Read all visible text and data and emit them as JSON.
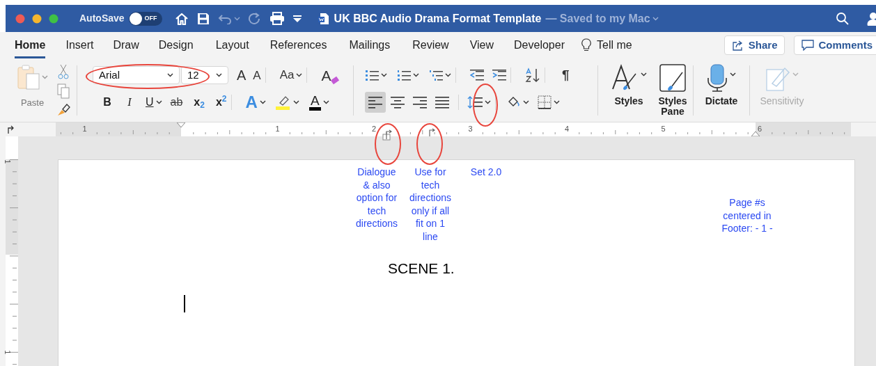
{
  "window": {
    "autosave_label": "AutoSave",
    "autosave": {
      "on": false,
      "label": "OFF"
    },
    "title": "UK BBC Audio Drama Format Template",
    "save_status": "— Saved to my Mac"
  },
  "tabs": [
    {
      "label": "Home",
      "selected": true
    },
    {
      "label": "Insert",
      "selected": false
    },
    {
      "label": "Draw",
      "selected": false
    },
    {
      "label": "Design",
      "selected": false
    },
    {
      "label": "Layout",
      "selected": false
    },
    {
      "label": "References",
      "selected": false
    },
    {
      "label": "Mailings",
      "selected": false
    },
    {
      "label": "Review",
      "selected": false
    },
    {
      "label": "View",
      "selected": false
    },
    {
      "label": "Developer",
      "selected": false
    }
  ],
  "tell_me": "Tell me",
  "header_buttons": [
    {
      "kind": "share",
      "label": "Share"
    },
    {
      "kind": "comments",
      "label": "Comments"
    }
  ],
  "ribbon": {
    "paste_label": "Paste",
    "font_name": "Arial",
    "font_size": "12",
    "font_row1": [
      {
        "kind": "grow",
        "text": "A"
      },
      {
        "kind": "shrink",
        "text": "A"
      },
      {
        "kind": "case",
        "text": "Aa"
      },
      {
        "kind": "clear",
        "text": "A"
      }
    ],
    "font_row2": [
      {
        "kind": "bold",
        "text": "B"
      },
      {
        "kind": "italic",
        "text": "I"
      },
      {
        "kind": "underline",
        "text": "U"
      },
      {
        "kind": "strike",
        "text": "ab"
      },
      {
        "kind": "subscript",
        "text": "x$_{2}$"
      },
      {
        "kind": "superscript",
        "text": "x$^{2}$"
      },
      {
        "kind": "effects",
        "text": "A"
      },
      {
        "kind": "highlight"
      },
      {
        "kind": "color",
        "text": "A"
      }
    ],
    "para_row1": [
      {
        "kind": "bullets"
      },
      {
        "kind": "numbering"
      },
      {
        "kind": "multilevel"
      },
      {
        "kind": "outdent"
      },
      {
        "kind": "indent"
      },
      {
        "kind": "sort"
      },
      {
        "kind": "marks",
        "text": "¶"
      }
    ],
    "para_row2": [
      {
        "kind": "align_left",
        "selected": true
      },
      {
        "kind": "align_center",
        "selected": false
      },
      {
        "kind": "align_right",
        "selected": false
      },
      {
        "kind": "justify",
        "selected": false
      },
      {
        "kind": "line_spacing"
      },
      {
        "kind": "shading"
      },
      {
        "kind": "borders"
      }
    ],
    "big_buttons": [
      {
        "kind": "styles",
        "label": "Styles",
        "disabled": false
      },
      {
        "kind": "styles_pane",
        "label": "Styles Pane",
        "disabled": false
      },
      {
        "kind": "dictate",
        "label": "Dictate",
        "disabled": false
      },
      {
        "kind": "sensitivity",
        "label": "Sensitivity",
        "disabled": true
      }
    ]
  },
  "ruler": {
    "labels": [
      "1",
      "1",
      "2",
      "3",
      "4",
      "5",
      "6"
    ],
    "vertical_labels": [
      "1",
      "1"
    ]
  },
  "document": {
    "notes": [
      "Dialogue & also option for tech directions",
      "Use for tech directions only if all fit on 1 line",
      "Set 2.0",
      "Page #s centered in Footer: - 1 -"
    ],
    "heading": "SCENE 1."
  }
}
